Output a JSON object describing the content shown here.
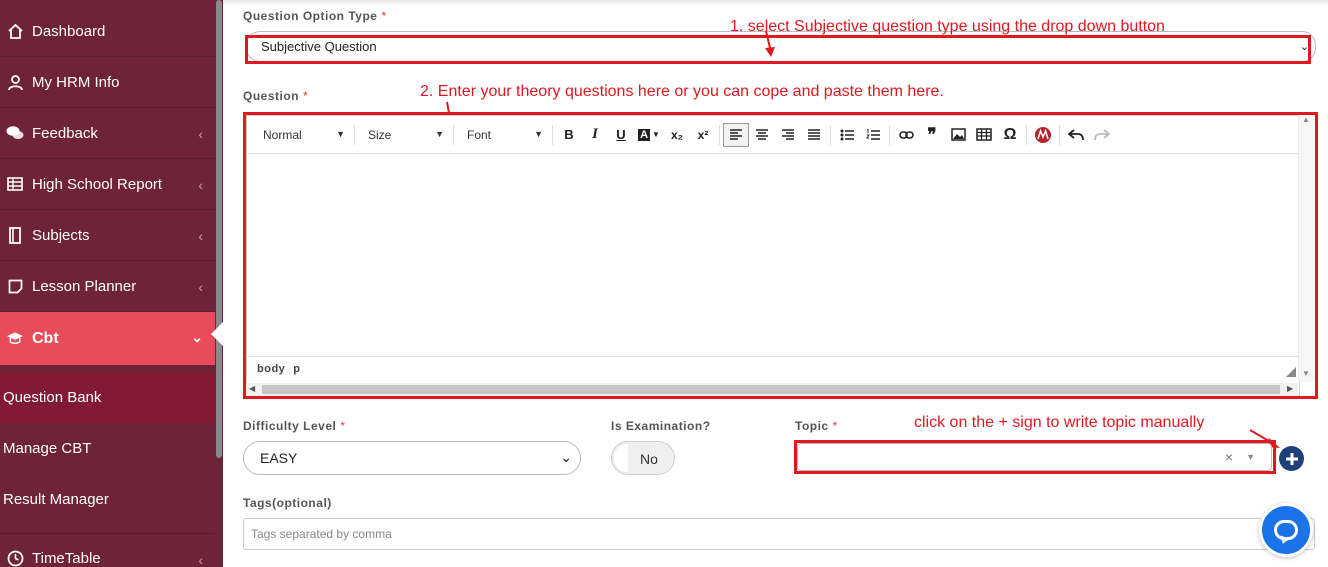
{
  "sidebar": {
    "items": [
      {
        "label": "Dashboard",
        "icon": "home-icon"
      },
      {
        "label": "My HRM Info",
        "icon": "user-icon"
      },
      {
        "label": "Feedback",
        "icon": "comments-icon"
      },
      {
        "label": "High School Report",
        "icon": "table-icon"
      },
      {
        "label": "Subjects",
        "icon": "book-icon"
      },
      {
        "label": "Lesson Planner",
        "icon": "note-icon"
      },
      {
        "label": "Cbt",
        "icon": "graduation-cap-icon"
      },
      {
        "label": "TimeTable",
        "icon": "clock-icon"
      }
    ],
    "subitems": [
      "Question Bank",
      "Manage CBT",
      "Result Manager"
    ]
  },
  "form": {
    "option_type_label": "Question Option Type",
    "option_type_value": "Subjective Question",
    "question_label": "Question",
    "difficulty_label": "Difficulty Level",
    "difficulty_value": "EASY",
    "exam_label": "Is Examination?",
    "exam_value": "No",
    "topic_label": "Topic",
    "topic_clear": "×",
    "tags_label": "Tags(optional)",
    "tags_placeholder": "Tags separated by comma",
    "required_mark": "*"
  },
  "editor": {
    "format_select": "Normal",
    "size_select": "Size",
    "font_select": "Font",
    "path": [
      "body",
      "p"
    ],
    "buttons": {
      "bold": "B",
      "italic": "I",
      "underline": "U",
      "color": "A",
      "subscript": "x₂",
      "superscript": "x²",
      "blockquote": "❞",
      "special_char": "Ω"
    }
  },
  "annotations": {
    "step1": "1. select Subjective question type using the drop down button",
    "step2": "2. Enter your theory questions here or you can cope and paste them here.",
    "topic_hint": "click on the + sign to write topic manually"
  },
  "colors": {
    "sidebar_bg": "#6e2338",
    "active_item": "#e84b5a",
    "current_sub": "#821a33",
    "annotation_red": "#e0191f",
    "plus_button": "#1f3f7a",
    "chat_button": "#1a73e8"
  }
}
